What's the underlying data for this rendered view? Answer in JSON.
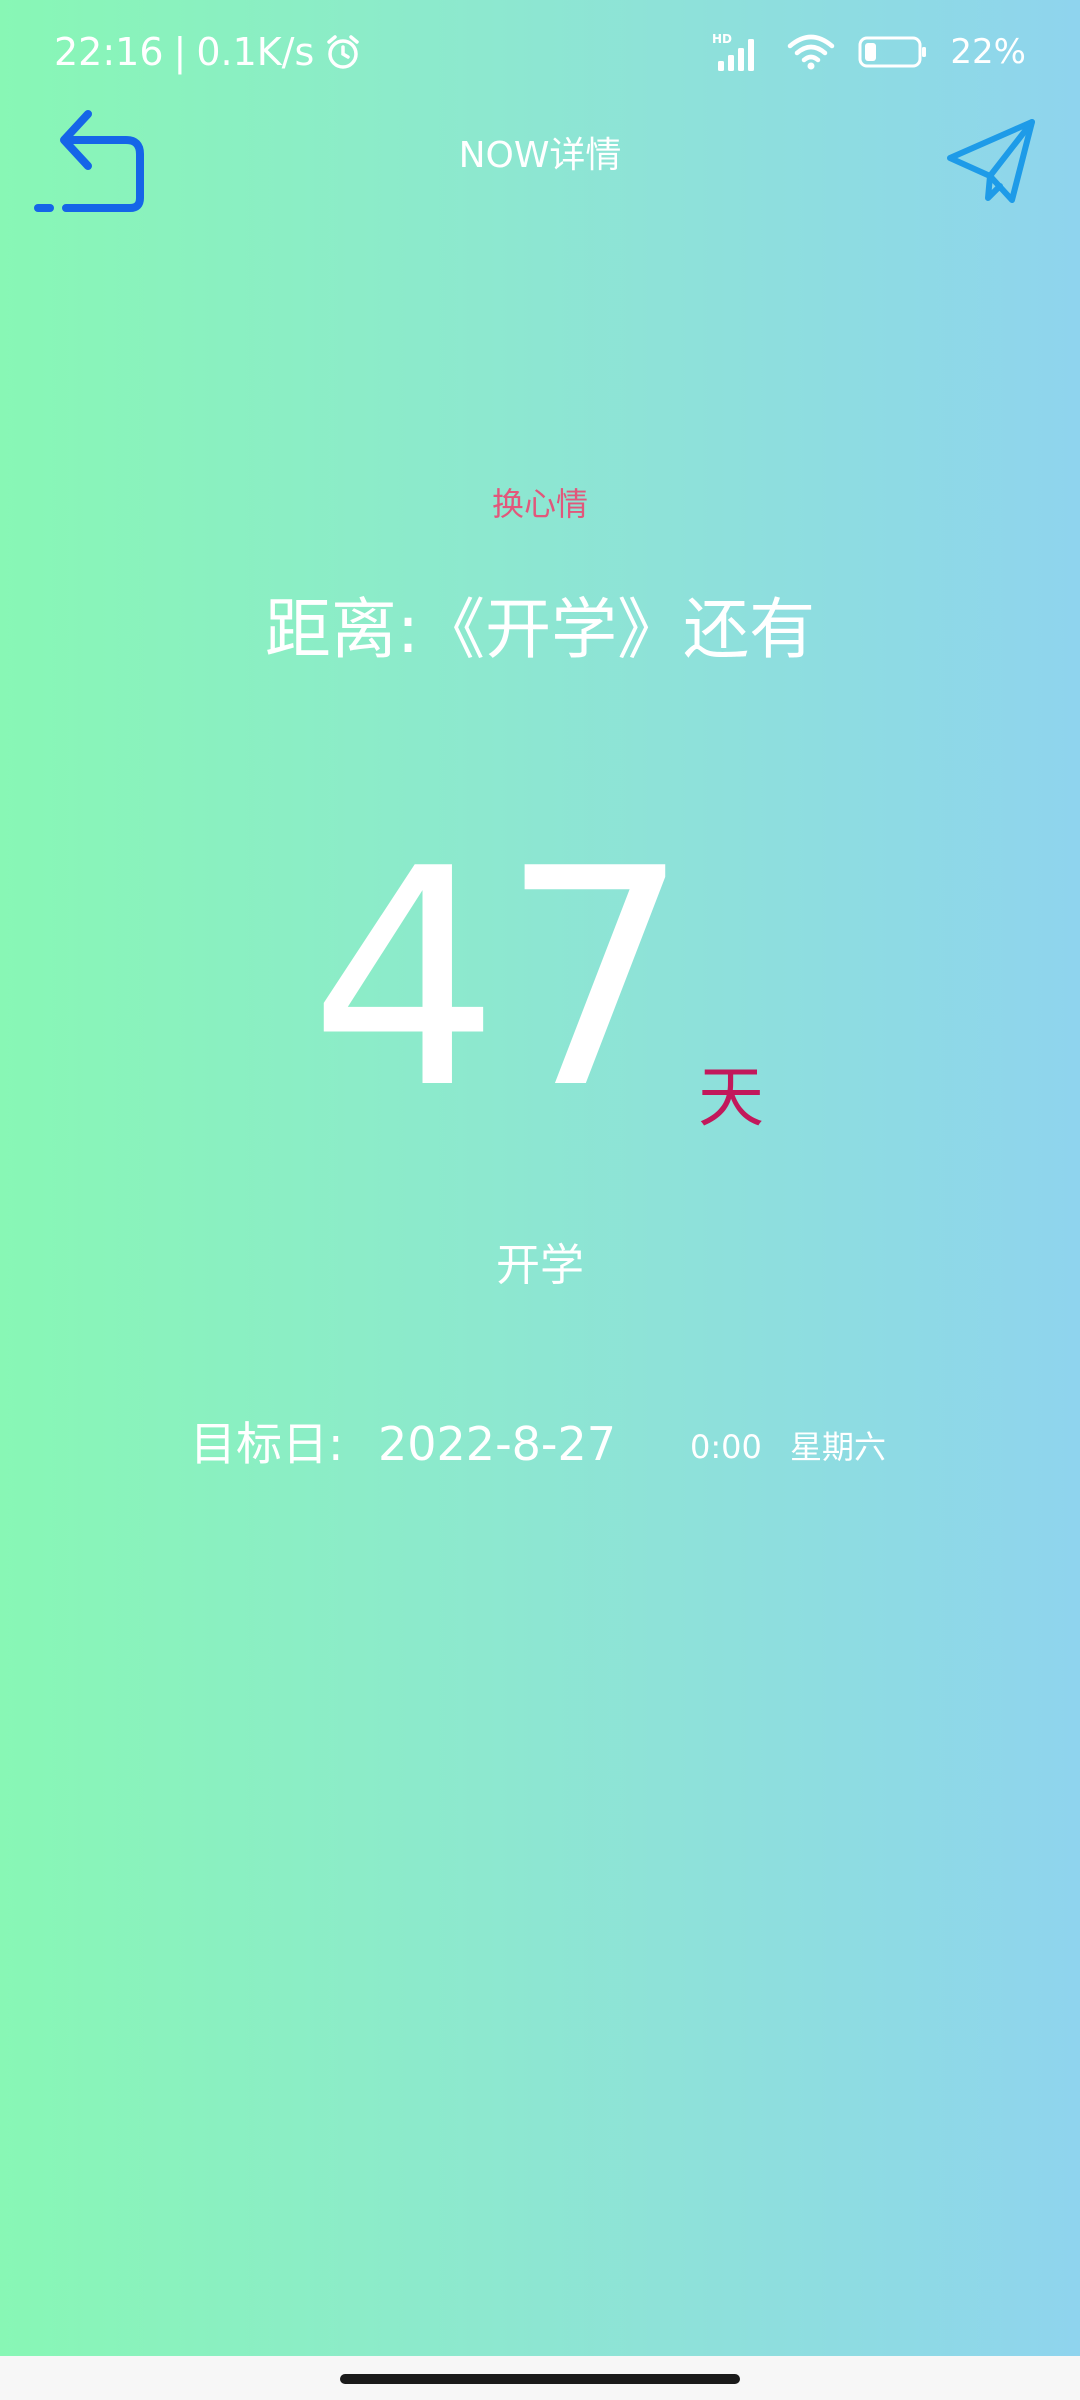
{
  "status_bar": {
    "time": "22:16",
    "separator": "|",
    "network_speed": "0.1K/s",
    "network_type": "HD",
    "battery_percent": "22%",
    "battery_level": 0.22,
    "icons": [
      "alarm-icon",
      "signal-icon",
      "wifi-icon",
      "battery-icon"
    ]
  },
  "header": {
    "title": "NOW详情",
    "back_icon": "back-arrow-icon",
    "share_icon": "send-paper-plane-icon"
  },
  "main": {
    "mood_link": "换心情",
    "distance_text": "距离:《开学》还有",
    "count": "47",
    "unit": "天",
    "event_name": "开学",
    "target_label": "目标日:",
    "target_date": "2022-8-27",
    "target_time": "0:00",
    "target_weekday": "星期六"
  },
  "colors": {
    "gradient_start": "#88f7b5",
    "gradient_end": "#8fd4ee",
    "accent_blue": "#1a73e8",
    "mood_pink": "#e2577b",
    "unit_magenta": "#c2185b"
  }
}
